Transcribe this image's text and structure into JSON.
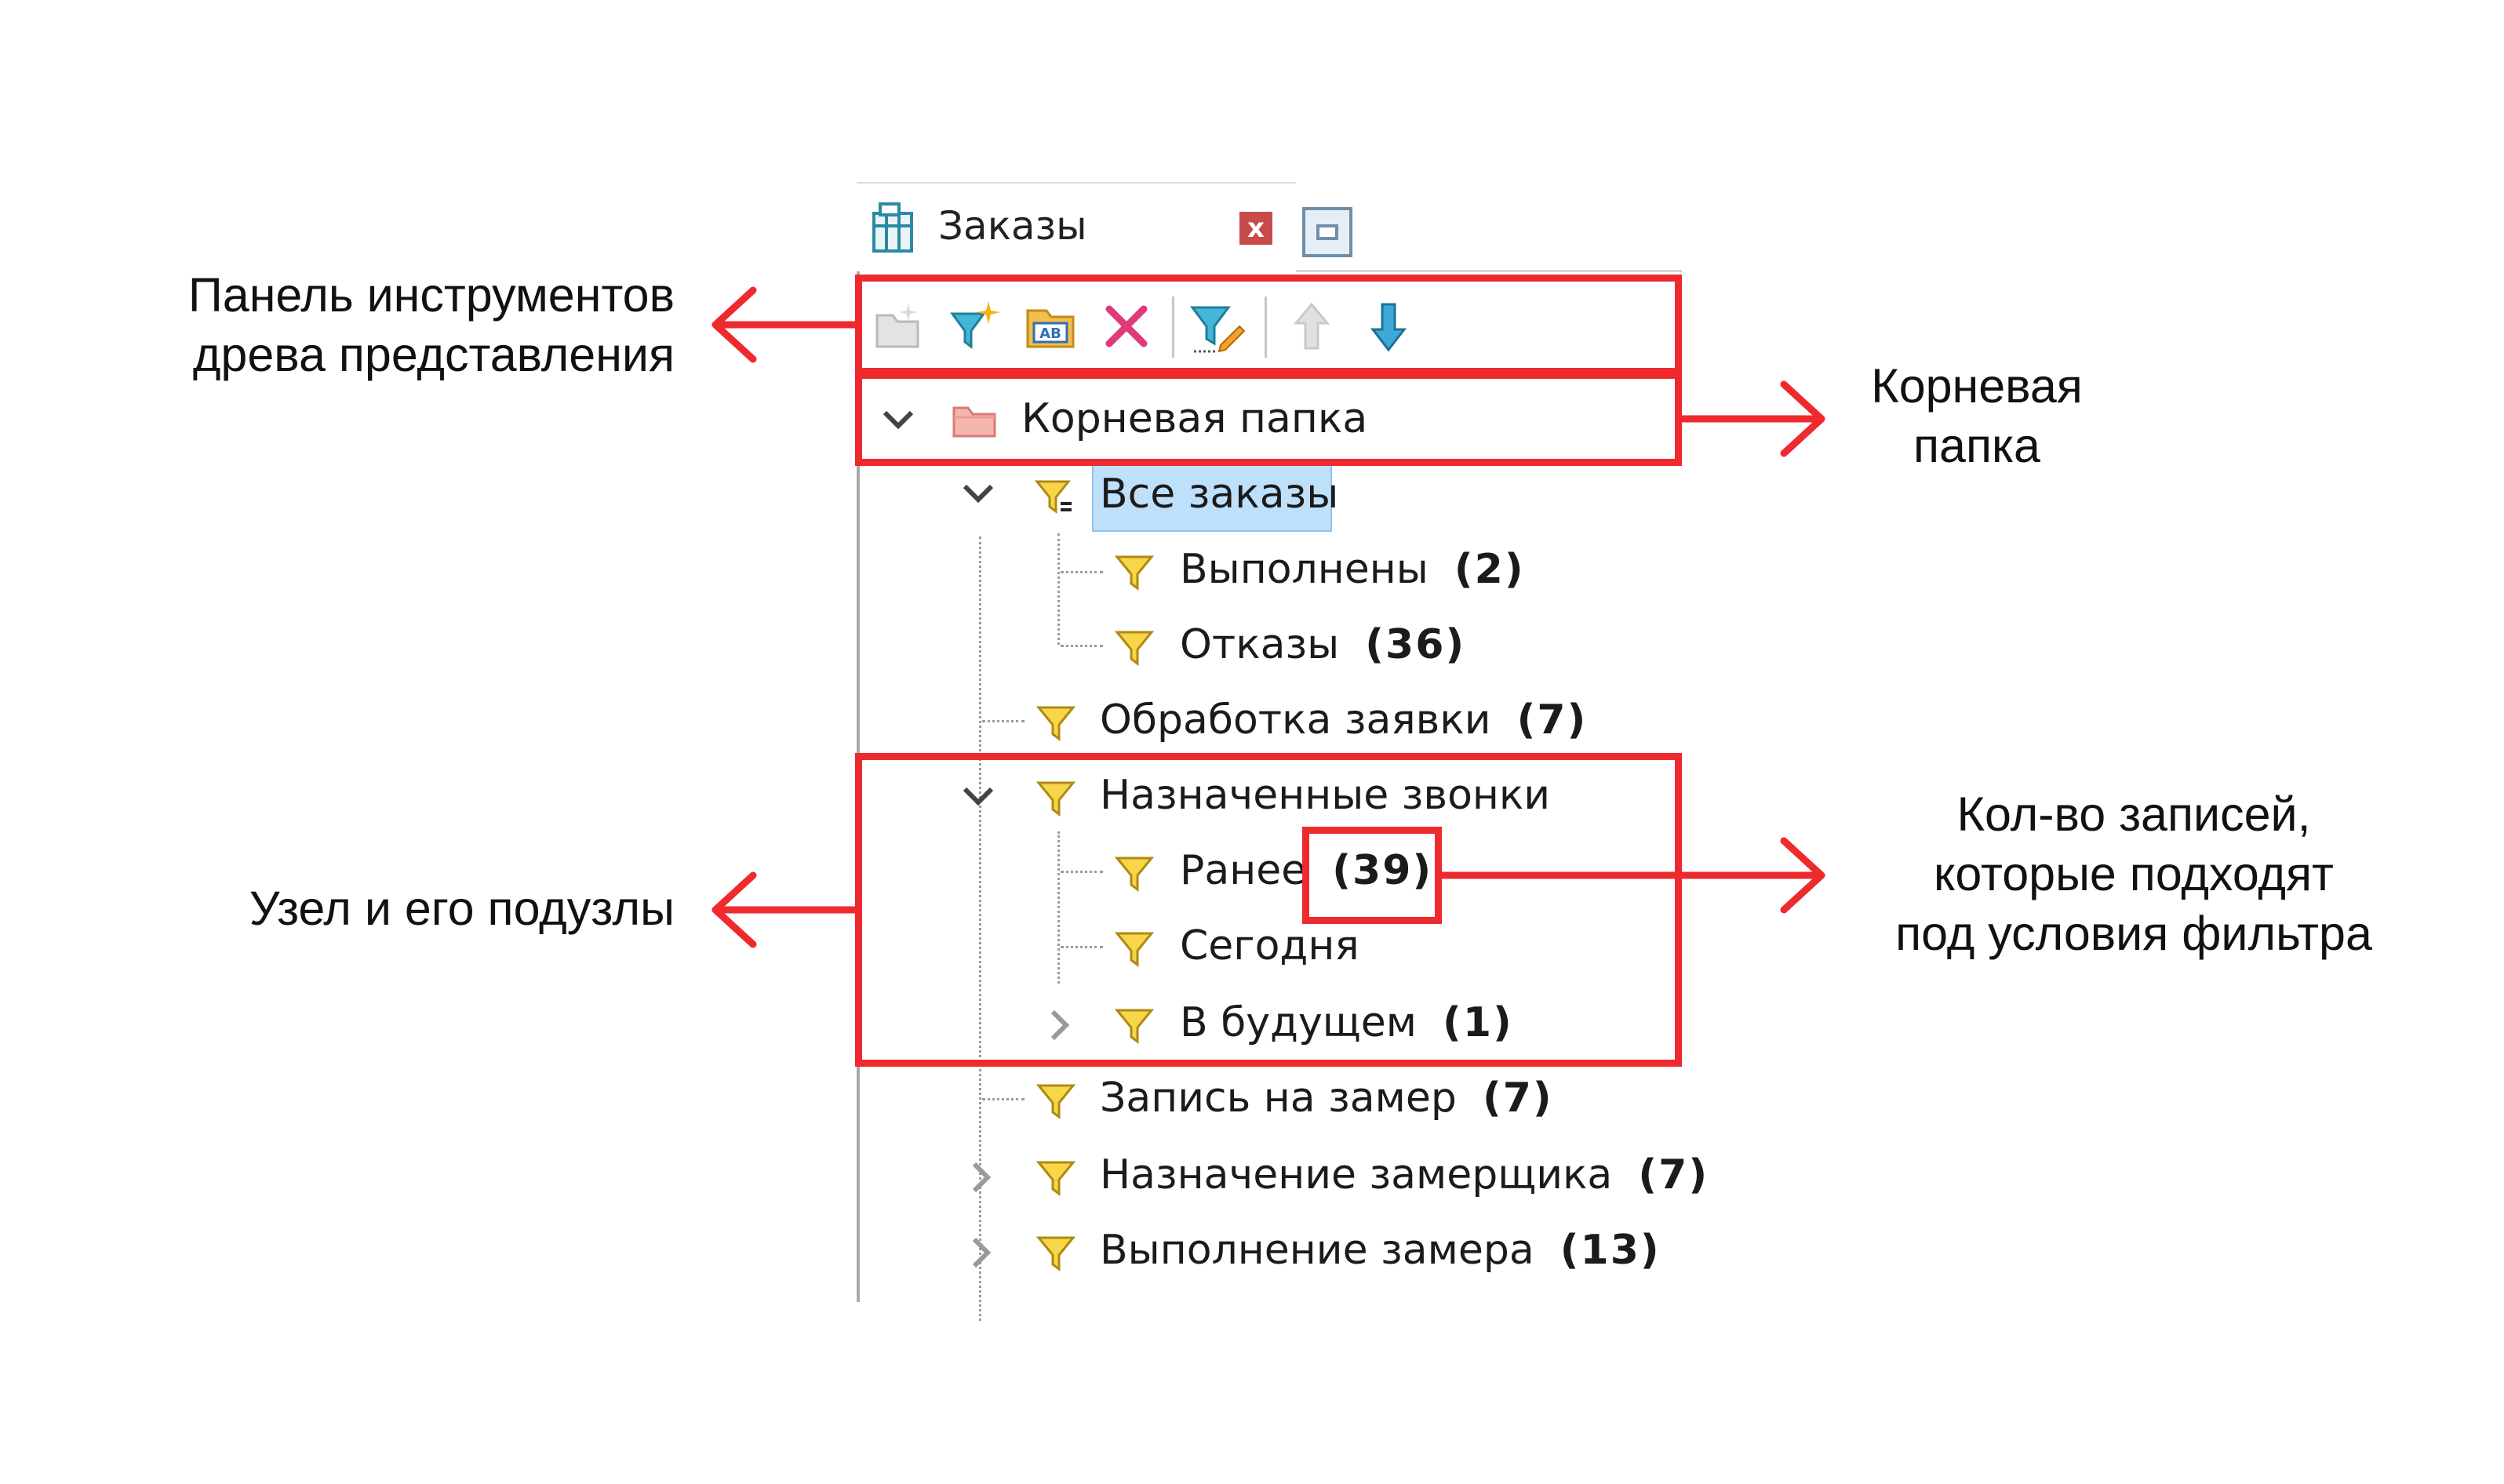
{
  "callouts": {
    "toolbar_label": [
      "Панель инструментов",
      "древа представления"
    ],
    "root_label": [
      "Корневая",
      "папка"
    ],
    "node_label": "Узел и его подузлы",
    "count_label": [
      "Кол-во записей,",
      "которые подходят",
      "под условия фильтра"
    ]
  },
  "panel": {
    "tab_title": "Заказы",
    "close_glyph": "x",
    "toolbar": [
      {
        "name": "new-folder",
        "icon": "folder-new-icon"
      },
      {
        "name": "new-filter",
        "icon": "filter-new-icon"
      },
      {
        "name": "rename",
        "icon": "rename-icon"
      },
      {
        "name": "delete",
        "icon": "delete-icon"
      },
      {
        "name": "edit-filter",
        "icon": "filter-edit-icon"
      },
      {
        "name": "move-up",
        "icon": "arrow-up-icon"
      },
      {
        "name": "move-down",
        "icon": "arrow-down-icon"
      }
    ]
  },
  "tree": {
    "root": "Корневая папка",
    "all_orders": "Все заказы",
    "completed": {
      "label": "Выполнены",
      "count": "(2)"
    },
    "refusals": {
      "label": "Отказы",
      "count": "(36)"
    },
    "processing": {
      "label": "Обработка заявки",
      "count": "(7)"
    },
    "assigned_calls": {
      "label": "Назначенные звонки"
    },
    "earlier": {
      "label": "Ранее",
      "count": "(39)"
    },
    "today": {
      "label": "Сегодня"
    },
    "future": {
      "label": "В будущем",
      "count": "(1)"
    },
    "measurement_booking": {
      "label": "Запись на замер",
      "count": "(7)"
    },
    "measurer_assignment": {
      "label": "Назначение замерщика",
      "count": "(7)"
    },
    "measurement_done": {
      "label": "Выполнение замера",
      "count": "(13)"
    }
  },
  "colors": {
    "annotation_red": "#ee2a2f",
    "selection_blue": "#bfe0fb",
    "funnel_yellow": "#f7d64a"
  }
}
